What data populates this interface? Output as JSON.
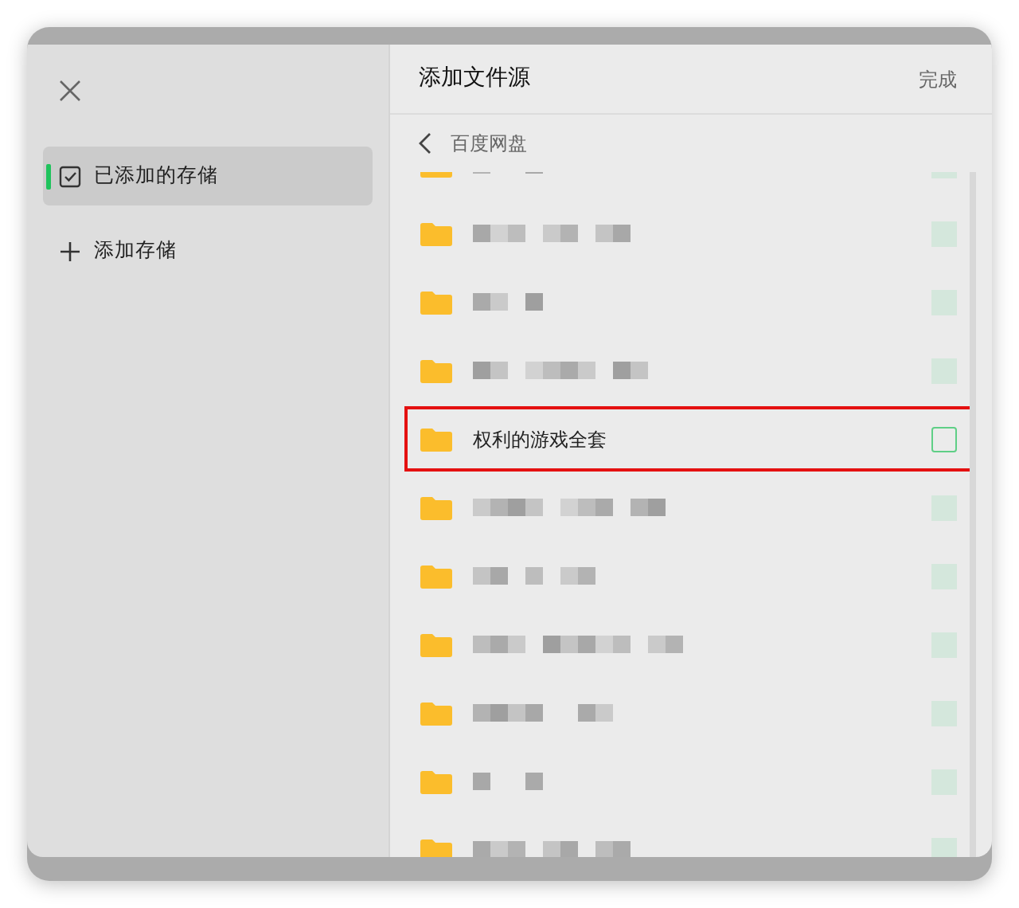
{
  "sidebar": {
    "items": [
      {
        "label": "已添加的存储",
        "kind": "check",
        "selected": true
      },
      {
        "label": "添加存储",
        "kind": "add",
        "selected": false
      }
    ]
  },
  "panel": {
    "title": "添加文件源",
    "done": "完成",
    "breadcrumb": "百度网盘"
  },
  "rows": [
    {
      "kind": "redacted",
      "highlighted": false
    },
    {
      "kind": "redacted",
      "highlighted": false
    },
    {
      "kind": "redacted",
      "highlighted": false
    },
    {
      "kind": "redacted",
      "highlighted": false
    },
    {
      "kind": "folder",
      "name": "权利的游戏全套",
      "checked": false,
      "highlighted": true
    },
    {
      "kind": "redacted",
      "highlighted": false
    },
    {
      "kind": "redacted",
      "highlighted": false
    },
    {
      "kind": "redacted",
      "highlighted": false
    },
    {
      "kind": "redacted",
      "highlighted": false
    },
    {
      "kind": "redacted",
      "highlighted": false
    },
    {
      "kind": "redacted",
      "highlighted": false
    }
  ]
}
